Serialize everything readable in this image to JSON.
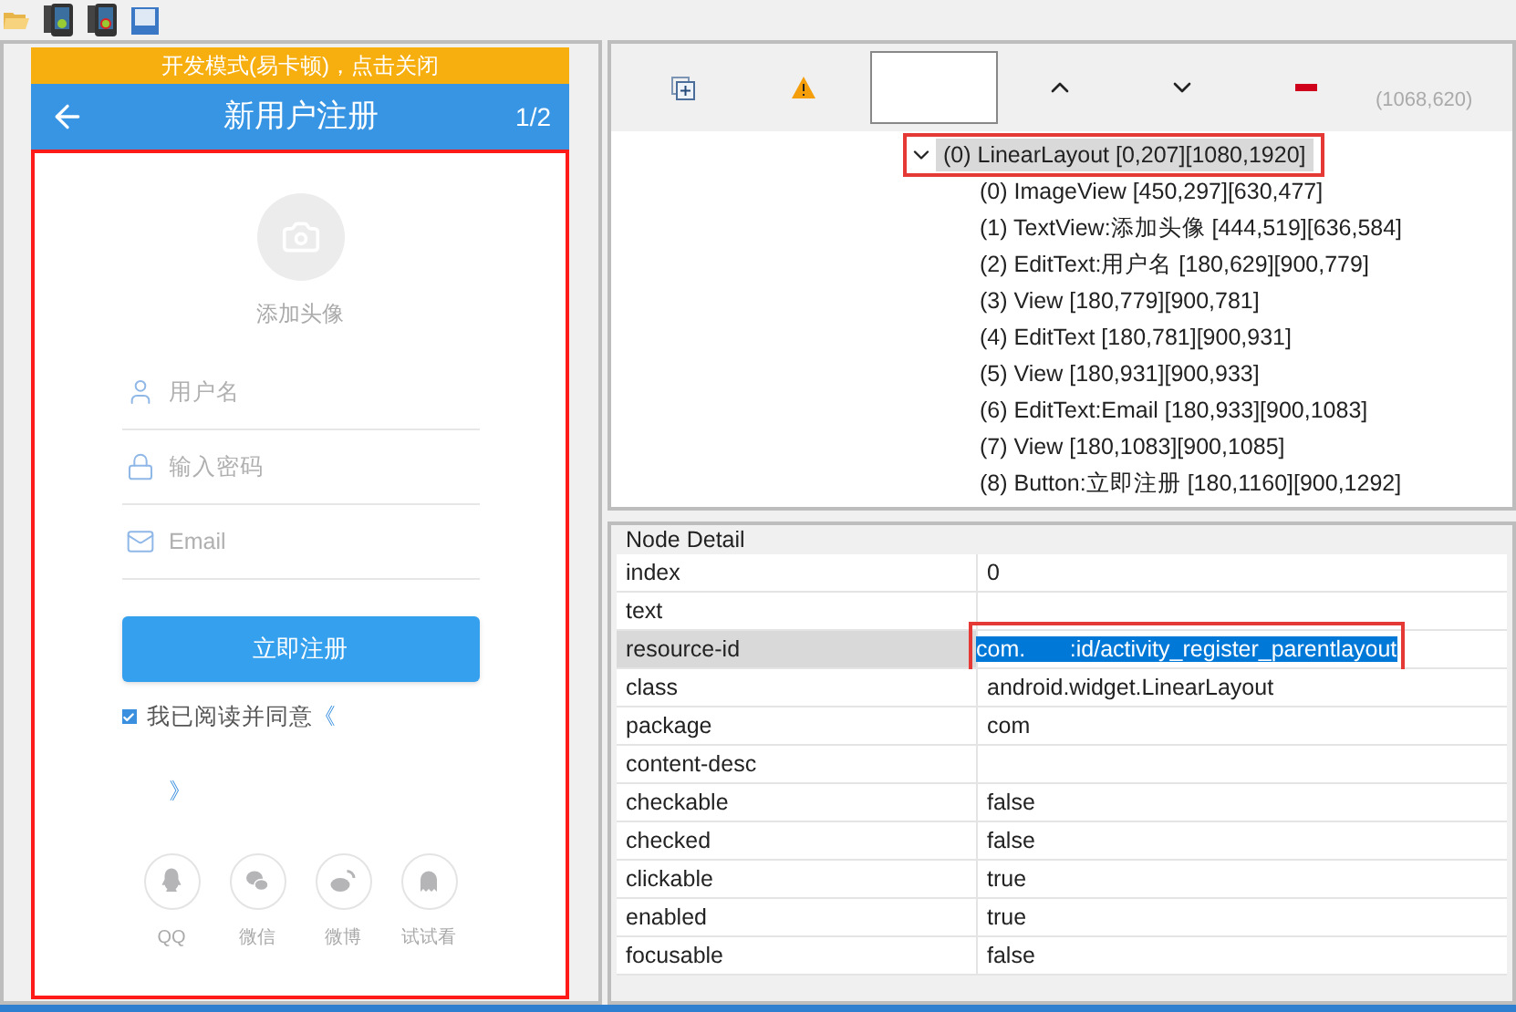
{
  "phone": {
    "dev_banner": "开发模式(易卡顿)，点击关闭",
    "title": "新用户注册",
    "page": "1/2",
    "avatar_label": "添加头像",
    "fields": [
      {
        "kind": "user",
        "placeholder": "用户名"
      },
      {
        "kind": "lock",
        "placeholder": "输入密码"
      },
      {
        "kind": "mail",
        "placeholder": "Email"
      }
    ],
    "register_button": "立即注册",
    "agree": {
      "checked": true,
      "text": "我已阅读并同意",
      "link_start": "《",
      "link_end": "》"
    },
    "social": [
      {
        "kind": "qq",
        "label": "QQ"
      },
      {
        "kind": "wechat",
        "label": "微信"
      },
      {
        "kind": "weibo",
        "label": "微博"
      },
      {
        "kind": "ghost",
        "label": "试试看"
      }
    ]
  },
  "coords": "(1068,620)",
  "tree": {
    "label": "(0) LinearLayout [0,207][1080,1920]",
    "expanded": true,
    "selected": true,
    "children": [
      {
        "label": "(0) ImageView [450,297][630,477]"
      },
      {
        "label": "(1) TextView:添加头像 [444,519][636,584]"
      },
      {
        "label": "(2) EditText:用户名 [180,629][900,779]"
      },
      {
        "label": "(3) View [180,779][900,781]"
      },
      {
        "label": "(4) EditText [180,781][900,931]"
      },
      {
        "label": "(5) View [180,931][900,933]"
      },
      {
        "label": "(6) EditText:Email [180,933][900,1083]"
      },
      {
        "label": "(7) View [180,1083][900,1085]"
      },
      {
        "label": "(8) Button:立即注册 [180,1160][900,1292]"
      }
    ]
  },
  "node_detail": {
    "title": "Node Detail",
    "rows": [
      {
        "key": "index",
        "value": "0",
        "selected": false
      },
      {
        "key": "text",
        "value": "",
        "selected": false
      },
      {
        "key": "resource-id",
        "value": "com.       :id/activity_register_parentlayout",
        "selected": true
      },
      {
        "key": "class",
        "value": "android.widget.LinearLayout",
        "selected": false
      },
      {
        "key": "package",
        "value": "com",
        "selected": false
      },
      {
        "key": "content-desc",
        "value": "",
        "selected": false
      },
      {
        "key": "checkable",
        "value": "false",
        "selected": false
      },
      {
        "key": "checked",
        "value": "false",
        "selected": false
      },
      {
        "key": "clickable",
        "value": "true",
        "selected": false
      },
      {
        "key": "enabled",
        "value": "true",
        "selected": false
      },
      {
        "key": "focusable",
        "value": "false",
        "selected": false
      }
    ]
  }
}
